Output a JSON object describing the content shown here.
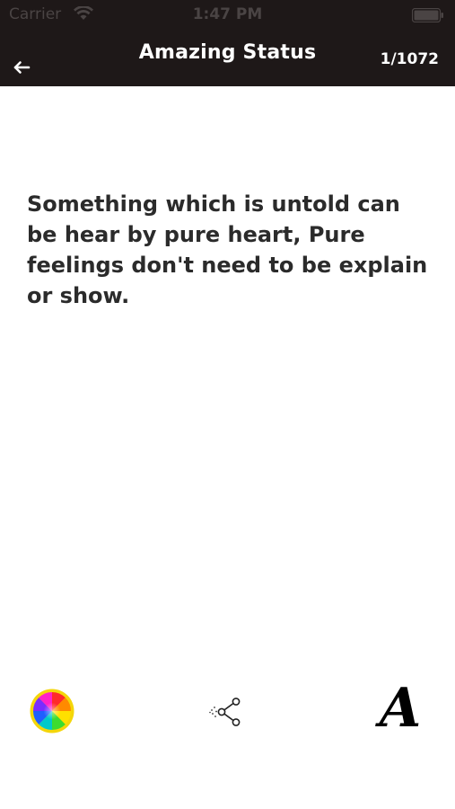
{
  "status_bar": {
    "carrier": "Carrier",
    "time": "1:47 PM"
  },
  "nav": {
    "title": "Amazing Status",
    "counter": "1/1072",
    "back_icon": "arrow-left-icon"
  },
  "quote": {
    "text": "Something which is untold can be hear by pure heart, Pure feelings don't need to be explain or show."
  },
  "toolbar": {
    "color_icon": "color-wheel-icon",
    "share_icon": "share-icon",
    "font_icon": "font-icon",
    "font_glyph": "A"
  },
  "colors": {
    "header_bg": "#1e1818",
    "text": "#2b2b2b",
    "background": "#ffffff"
  }
}
